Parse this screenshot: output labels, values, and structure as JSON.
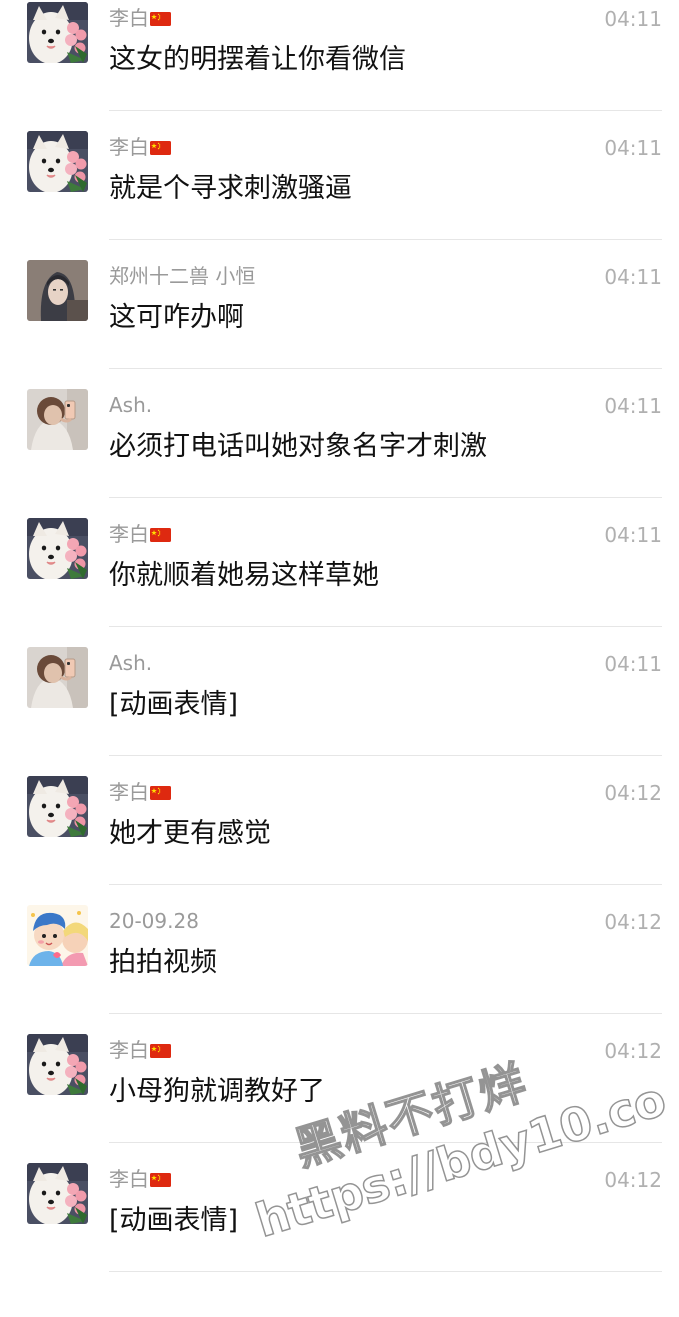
{
  "messages": [
    {
      "sender": "李白",
      "flag": true,
      "avatar": "samoyed-dog",
      "time": "04:11",
      "text": "这女的明摆着让你看微信"
    },
    {
      "sender": "李白",
      "flag": true,
      "avatar": "samoyed-dog",
      "time": "04:11",
      "text": "就是个寻求刺激骚逼"
    },
    {
      "sender": "郑州十二兽  小恒",
      "flag": false,
      "avatar": "person-hood",
      "time": "04:11",
      "text": "这可咋办啊"
    },
    {
      "sender": "Ash.",
      "flag": false,
      "avatar": "selfie-mirror",
      "time": "04:11",
      "text": "必须打电话叫她对象名字才刺激"
    },
    {
      "sender": "李白",
      "flag": true,
      "avatar": "samoyed-dog",
      "time": "04:11",
      "text": "你就顺着她易这样草她"
    },
    {
      "sender": "Ash.",
      "flag": false,
      "avatar": "selfie-mirror",
      "time": "04:11",
      "text": "[动画表情]"
    },
    {
      "sender": "李白",
      "flag": true,
      "avatar": "samoyed-dog",
      "time": "04:12",
      "text": "她才更有感觉"
    },
    {
      "sender": "20-09.28",
      "flag": false,
      "avatar": "cartoon-couple",
      "time": "04:12",
      "text": "拍拍视频"
    },
    {
      "sender": "李白",
      "flag": true,
      "avatar": "samoyed-dog",
      "time": "04:12",
      "text": "小母狗就调教好了"
    },
    {
      "sender": "李白",
      "flag": true,
      "avatar": "samoyed-dog",
      "time": "04:12",
      "text": "[动画表情]"
    }
  ],
  "watermark": {
    "line1": "黑料不打烊",
    "line2": "https://bdy10.co"
  },
  "colors": {
    "name": "#9a9a9a",
    "time": "#b0b0b0",
    "message": "#111111",
    "divider": "#e6e6e6"
  }
}
